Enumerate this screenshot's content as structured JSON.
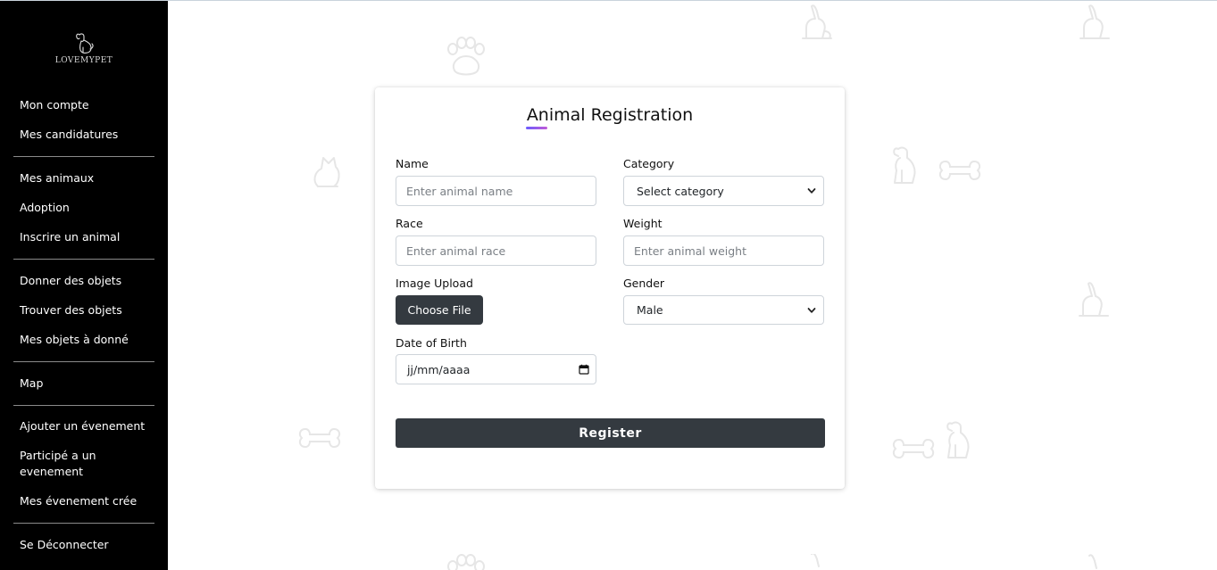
{
  "app": {
    "logo_text": "LOVEMYPET"
  },
  "sidebar": {
    "items": [
      {
        "label": "Mon compte"
      },
      {
        "label": "Mes candidatures"
      },
      {
        "label": "Mes animaux"
      },
      {
        "label": "Adoption"
      },
      {
        "label": "Inscrire un animal"
      },
      {
        "label": "Donner des objets"
      },
      {
        "label": "Trouver des objets"
      },
      {
        "label": "Mes objets à donné"
      },
      {
        "label": "Map"
      },
      {
        "label": "Ajouter un évenement"
      },
      {
        "label": "Participé a un evenement"
      },
      {
        "label": "Mes évenement crée"
      },
      {
        "label": "Se Déconnecter"
      }
    ]
  },
  "form": {
    "title": "Animal Registration",
    "name": {
      "label": "Name",
      "placeholder": "Enter animal name"
    },
    "category": {
      "label": "Category",
      "selected": "Select category"
    },
    "race": {
      "label": "Race",
      "placeholder": "Enter animal race"
    },
    "weight": {
      "label": "Weight",
      "placeholder": "Enter animal weight"
    },
    "image": {
      "label": "Image Upload",
      "button": "Choose File"
    },
    "gender": {
      "label": "Gender",
      "selected": "Male"
    },
    "dob": {
      "label": "Date of Birth",
      "placeholder": "jj/mm/aaaa"
    },
    "submit_label": "Register"
  },
  "colors": {
    "sidebar_bg": "#000000",
    "button_bg": "#343a40",
    "title_accent_start": "#6a5cff",
    "title_accent_end": "#c25bd6",
    "decor": "#e6e6e6"
  },
  "decorations": [
    "rabbit-icon",
    "paw-icon",
    "cat-icon",
    "dog-icon",
    "bone-icon"
  ]
}
